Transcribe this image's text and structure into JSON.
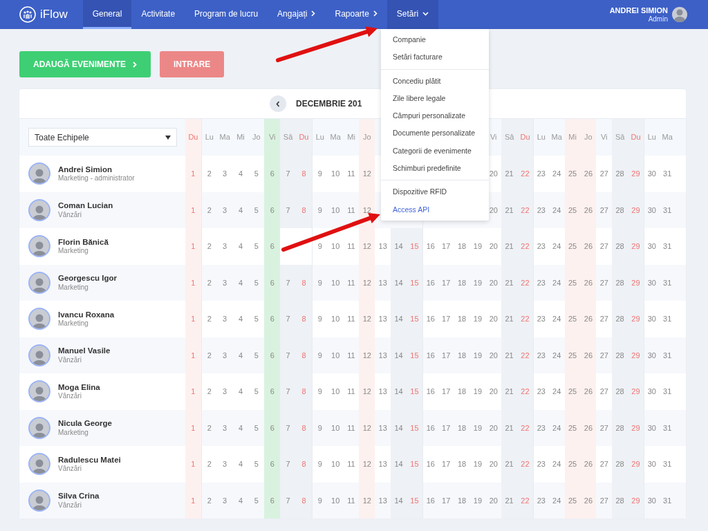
{
  "navbar": {
    "logo": "iFlow",
    "items": [
      {
        "label": "General",
        "selected": true,
        "expanded": false,
        "kind": "plain"
      },
      {
        "label": "Activitate",
        "selected": false,
        "expanded": false,
        "kind": "plain"
      },
      {
        "label": "Program de lucru",
        "selected": false,
        "expanded": false,
        "kind": "plain"
      },
      {
        "label": "Angajați",
        "selected": false,
        "expanded": false,
        "kind": "submenu"
      },
      {
        "label": "Rapoarte",
        "selected": false,
        "expanded": false,
        "kind": "submenu"
      },
      {
        "label": "Setări",
        "selected": false,
        "expanded": true,
        "kind": "dropdown"
      }
    ],
    "user": {
      "name": "ANDREI SIMION",
      "role": "Admin"
    }
  },
  "actions": [
    {
      "label": "ADAUGĂ EVENIMENTE",
      "kind": "add"
    },
    {
      "label": "INTRARE",
      "kind": "entry"
    }
  ],
  "settings_menu": {
    "groups": [
      [
        {
          "label": "Companie",
          "selected": false
        },
        {
          "label": "Setări facturare",
          "selected": false
        }
      ],
      [
        {
          "label": "Concediu plătit",
          "selected": false
        },
        {
          "label": "Zile libere legale",
          "selected": false
        },
        {
          "label": "Câmpuri personalizate",
          "selected": false
        },
        {
          "label": "Documente personalizate",
          "selected": false
        },
        {
          "label": "Categorii de evenimente",
          "selected": false
        },
        {
          "label": "Schimburi predefinite",
          "selected": false
        }
      ],
      [
        {
          "label": "Dispozitive RFID",
          "selected": false
        },
        {
          "label": "Access API",
          "selected": true
        }
      ]
    ]
  },
  "calendar": {
    "title": "DECEMBRIE 201",
    "team_filter": "Toate Echipele",
    "days": [
      {
        "label": "Du",
        "kind": "sunday",
        "holiday": true,
        "today": false
      },
      {
        "label": "Lu",
        "kind": "weekday",
        "holiday": false,
        "today": false
      },
      {
        "label": "Ma",
        "kind": "weekday",
        "holiday": false,
        "today": false
      },
      {
        "label": "Mi",
        "kind": "weekday",
        "holiday": false,
        "today": false
      },
      {
        "label": "Jo",
        "kind": "weekday",
        "holiday": false,
        "today": false
      },
      {
        "label": "Vi",
        "kind": "weekday",
        "holiday": false,
        "today": true
      },
      {
        "label": "Sâ",
        "kind": "saturday",
        "holiday": false,
        "today": false
      },
      {
        "label": "Du",
        "kind": "sunday",
        "holiday": false,
        "today": false
      },
      {
        "label": "Lu",
        "kind": "weekday",
        "holiday": false,
        "today": false
      },
      {
        "label": "Ma",
        "kind": "weekday",
        "holiday": false,
        "today": false
      },
      {
        "label": "Mi",
        "kind": "weekday",
        "holiday": false,
        "today": false
      },
      {
        "label": "Jo",
        "kind": "weekday",
        "holiday": true,
        "today": false
      },
      {
        "kind": "weekday",
        "holiday": false,
        "today": false
      },
      {
        "kind": "saturday",
        "holiday": false,
        "today": false
      },
      {
        "kind": "sunday",
        "holiday": false,
        "today": false
      },
      {
        "kind": "weekday",
        "holiday": false,
        "today": false
      },
      {
        "kind": "weekday",
        "holiday": false,
        "today": false
      },
      {
        "kind": "weekday",
        "holiday": false,
        "today": false
      },
      {
        "kind": "weekday",
        "holiday": false,
        "today": false
      },
      {
        "label": "Vi",
        "kind": "weekday",
        "holiday": false,
        "today": false
      },
      {
        "label": "Sâ",
        "kind": "saturday",
        "holiday": false,
        "today": false
      },
      {
        "label": "Du",
        "kind": "sunday",
        "holiday": false,
        "today": false
      },
      {
        "label": "Lu",
        "kind": "weekday",
        "holiday": false,
        "today": false
      },
      {
        "label": "Ma",
        "kind": "weekday",
        "holiday": false,
        "today": false
      },
      {
        "label": "Mi",
        "kind": "weekday",
        "holiday": true,
        "today": false
      },
      {
        "label": "Jo",
        "kind": "weekday",
        "holiday": true,
        "today": false
      },
      {
        "label": "Vi",
        "kind": "weekday",
        "holiday": false,
        "today": false
      },
      {
        "label": "Sâ",
        "kind": "saturday",
        "holiday": false,
        "today": false
      },
      {
        "label": "Du",
        "kind": "sunday",
        "holiday": false,
        "today": false
      },
      {
        "label": "Lu",
        "kind": "weekday",
        "holiday": false,
        "today": false
      },
      {
        "label": "Ma",
        "kind": "weekday",
        "holiday": false,
        "today": false
      }
    ],
    "rows": [
      {
        "name": "Andrei Simion",
        "team": "Marketing - administrator",
        "days": [
          {
            "text": "1"
          },
          {
            "text": "2"
          },
          {
            "text": "3"
          },
          {
            "text": "4"
          },
          {
            "text": "5"
          },
          {
            "text": "6"
          },
          {
            "text": "7"
          },
          {
            "text": "8"
          },
          {
            "text": "9"
          },
          {
            "text": "10"
          },
          {
            "text": "11"
          },
          {
            "text": "12"
          }
        ],
        "days_right": [
          {
            "text": "20"
          },
          {
            "text": "21"
          },
          {
            "text": "22"
          },
          {
            "text": "23"
          },
          {
            "text": "24"
          },
          {
            "text": "25"
          },
          {
            "text": "26"
          },
          {
            "text": "27"
          },
          {
            "text": "28"
          },
          {
            "text": "29"
          },
          {
            "text": "30"
          },
          {
            "text": "31"
          }
        ]
      },
      {
        "name": "Coman Lucian",
        "team": "Vânzări",
        "days": [
          {
            "text": "1"
          },
          {
            "text": "2"
          },
          {
            "text": "3"
          },
          {
            "text": "4"
          },
          {
            "text": "5"
          },
          {
            "text": "6"
          },
          {
            "text": "7"
          },
          {
            "text": "8"
          },
          {
            "text": "9"
          },
          {
            "text": "10"
          },
          {
            "text": "11"
          },
          {
            "text": "12"
          }
        ],
        "days_right": [
          {
            "text": "20"
          },
          {
            "text": "21"
          },
          {
            "text": "22"
          },
          {
            "text": "23"
          },
          {
            "text": "24"
          },
          {
            "text": "25"
          },
          {
            "text": "26"
          },
          {
            "text": "27"
          },
          {
            "text": "28"
          },
          {
            "text": "29"
          },
          {
            "text": "30"
          },
          {
            "text": "31"
          }
        ]
      },
      {
        "name": "Florin Bănică",
        "team": "Marketing",
        "days": [
          {
            "text": "1"
          },
          {
            "text": "2"
          },
          {
            "text": "3"
          },
          {
            "text": "4"
          },
          {
            "text": "5"
          },
          {
            "text": "6"
          }
        ],
        "days_right": [
          {
            "text": "9"
          },
          {
            "text": "10"
          },
          {
            "text": "11"
          },
          {
            "text": "12"
          },
          {
            "text": "13"
          },
          {
            "text": "14"
          },
          {
            "text": "15"
          },
          {
            "text": "16"
          },
          {
            "text": "17"
          },
          {
            "text": "18"
          },
          {
            "text": "19"
          },
          {
            "text": "20"
          },
          {
            "text": "21"
          },
          {
            "text": "22"
          },
          {
            "text": "23"
          },
          {
            "text": "24"
          },
          {
            "text": "25"
          },
          {
            "text": "26"
          },
          {
            "text": "27"
          },
          {
            "text": "28"
          },
          {
            "text": "29"
          },
          {
            "text": "30"
          },
          {
            "text": "31"
          }
        ]
      },
      {
        "name": "Georgescu Igor",
        "team": "Marketing",
        "days": [
          {
            "text": "1"
          },
          {
            "text": "2"
          },
          {
            "text": "3"
          },
          {
            "text": "4"
          },
          {
            "text": "5"
          },
          {
            "text": "6"
          },
          {
            "text": "7"
          },
          {
            "text": "8"
          },
          {
            "text": "9"
          },
          {
            "text": "10"
          },
          {
            "text": "11"
          },
          {
            "text": "12"
          },
          {
            "text": "13"
          },
          {
            "text": "14"
          },
          {
            "text": "15"
          },
          {
            "text": "16"
          },
          {
            "text": "17"
          },
          {
            "text": "18"
          },
          {
            "text": "19"
          },
          {
            "text": "20"
          },
          {
            "text": "21"
          },
          {
            "text": "22"
          },
          {
            "text": "23"
          },
          {
            "text": "24"
          },
          {
            "text": "25"
          },
          {
            "text": "26"
          },
          {
            "text": "27"
          },
          {
            "text": "28"
          },
          {
            "text": "29"
          },
          {
            "text": "30"
          },
          {
            "text": "31"
          }
        ]
      },
      {
        "name": "Ivancu Roxana",
        "team": "Marketing",
        "days": [
          {
            "text": "1"
          },
          {
            "text": "2"
          },
          {
            "text": "3"
          },
          {
            "text": "4"
          },
          {
            "text": "5"
          },
          {
            "text": "6"
          },
          {
            "text": "7"
          },
          {
            "text": "8"
          },
          {
            "text": "9"
          },
          {
            "text": "10"
          },
          {
            "text": "11"
          },
          {
            "text": "12"
          },
          {
            "text": "13"
          },
          {
            "text": "14"
          },
          {
            "text": "15"
          },
          {
            "text": "16"
          },
          {
            "text": "17"
          },
          {
            "text": "18"
          },
          {
            "text": "19"
          },
          {
            "text": "20"
          },
          {
            "text": "21"
          },
          {
            "text": "22"
          },
          {
            "text": "23"
          },
          {
            "text": "24"
          },
          {
            "text": "25"
          },
          {
            "text": "26"
          },
          {
            "text": "27"
          },
          {
            "text": "28"
          },
          {
            "text": "29"
          },
          {
            "text": "30"
          },
          {
            "text": "31"
          }
        ]
      },
      {
        "name": "Manuel Vasile",
        "team": "Vânzări",
        "days": [
          {
            "text": "1"
          },
          {
            "text": "2"
          },
          {
            "text": "3"
          },
          {
            "text": "4"
          },
          {
            "text": "5"
          },
          {
            "text": "6"
          },
          {
            "text": "7"
          },
          {
            "text": "8"
          },
          {
            "text": "9"
          },
          {
            "text": "10"
          },
          {
            "text": "11"
          },
          {
            "text": "12"
          },
          {
            "text": "13"
          },
          {
            "text": "14"
          },
          {
            "text": "15"
          },
          {
            "text": "16"
          },
          {
            "text": "17"
          },
          {
            "text": "18"
          },
          {
            "text": "19"
          },
          {
            "text": "20"
          },
          {
            "text": "21"
          },
          {
            "text": "22"
          },
          {
            "text": "23"
          },
          {
            "text": "24"
          },
          {
            "text": "25"
          },
          {
            "text": "26"
          },
          {
            "text": "27"
          },
          {
            "text": "28"
          },
          {
            "text": "29"
          },
          {
            "text": "30"
          },
          {
            "text": "31"
          }
        ]
      },
      {
        "name": "Moga Elina",
        "team": "Vânzări",
        "days": [
          {
            "text": "1"
          },
          {
            "text": "2"
          },
          {
            "text": "3"
          },
          {
            "text": "4"
          },
          {
            "text": "5"
          },
          {
            "text": "6"
          },
          {
            "text": "7"
          },
          {
            "text": "8"
          },
          {
            "text": "9"
          },
          {
            "text": "10"
          },
          {
            "text": "11"
          },
          {
            "text": "12"
          },
          {
            "text": "13"
          },
          {
            "text": "14"
          },
          {
            "text": "15"
          },
          {
            "text": "16"
          },
          {
            "text": "17"
          },
          {
            "text": "18"
          },
          {
            "text": "19"
          },
          {
            "text": "20"
          },
          {
            "text": "21"
          },
          {
            "text": "22"
          },
          {
            "text": "23"
          },
          {
            "text": "24"
          },
          {
            "text": "25"
          },
          {
            "text": "26"
          },
          {
            "text": "27"
          },
          {
            "text": "28"
          },
          {
            "text": "29"
          },
          {
            "text": "30"
          },
          {
            "text": "31"
          }
        ]
      },
      {
        "name": "Nicula George",
        "team": "Marketing",
        "days": [
          {
            "text": "1"
          },
          {
            "text": "2"
          },
          {
            "text": "3"
          },
          {
            "text": "4"
          },
          {
            "text": "5"
          },
          {
            "text": "6"
          },
          {
            "text": "7"
          },
          {
            "text": "8"
          },
          {
            "text": "9"
          },
          {
            "text": "10"
          },
          {
            "text": "11"
          },
          {
            "text": "12"
          },
          {
            "text": "13"
          },
          {
            "text": "14"
          },
          {
            "text": "15"
          },
          {
            "text": "16"
          },
          {
            "text": "17"
          },
          {
            "text": "18"
          },
          {
            "text": "19"
          },
          {
            "text": "20"
          },
          {
            "text": "21"
          },
          {
            "text": "22"
          },
          {
            "text": "23"
          },
          {
            "text": "24"
          },
          {
            "text": "25"
          },
          {
            "text": "26"
          },
          {
            "text": "27"
          },
          {
            "text": "28"
          },
          {
            "text": "29"
          },
          {
            "text": "30"
          },
          {
            "text": "31"
          }
        ]
      },
      {
        "name": "Radulescu Matei",
        "team": "Vânzări",
        "days": [
          {
            "text": "1"
          },
          {
            "text": "2"
          },
          {
            "text": "3"
          },
          {
            "text": "4"
          },
          {
            "text": "5"
          },
          {
            "text": "6"
          },
          {
            "text": "7"
          },
          {
            "text": "8"
          },
          {
            "text": "9"
          },
          {
            "text": "10"
          },
          {
            "text": "11"
          },
          {
            "text": "12"
          },
          {
            "text": "13"
          },
          {
            "text": "14"
          },
          {
            "text": "15"
          },
          {
            "text": "16"
          },
          {
            "text": "17"
          },
          {
            "text": "18"
          },
          {
            "text": "19"
          },
          {
            "text": "20"
          },
          {
            "text": "21"
          },
          {
            "text": "22"
          },
          {
            "text": "23"
          },
          {
            "text": "24"
          },
          {
            "text": "25"
          },
          {
            "text": "26"
          },
          {
            "text": "27"
          },
          {
            "text": "28"
          },
          {
            "text": "29"
          },
          {
            "text": "30"
          },
          {
            "text": "31"
          }
        ]
      },
      {
        "name": "Silva Crina",
        "team": "Vânzări",
        "days": [
          {
            "text": "1"
          },
          {
            "text": "2"
          },
          {
            "text": "3"
          },
          {
            "text": "4"
          },
          {
            "text": "5"
          },
          {
            "text": "6"
          },
          {
            "text": "7"
          },
          {
            "text": "8"
          },
          {
            "text": "9"
          },
          {
            "text": "10"
          },
          {
            "text": "11"
          },
          {
            "text": "12"
          },
          {
            "text": "13"
          },
          {
            "text": "14"
          },
          {
            "text": "15"
          },
          {
            "text": "16"
          },
          {
            "text": "17"
          },
          {
            "text": "18"
          },
          {
            "text": "19"
          },
          {
            "text": "20"
          },
          {
            "text": "21"
          },
          {
            "text": "22"
          },
          {
            "text": "23"
          },
          {
            "text": "24"
          },
          {
            "text": "25"
          },
          {
            "text": "26"
          },
          {
            "text": "27"
          },
          {
            "text": "28"
          },
          {
            "text": "29"
          },
          {
            "text": "30"
          },
          {
            "text": "31"
          }
        ]
      }
    ]
  }
}
